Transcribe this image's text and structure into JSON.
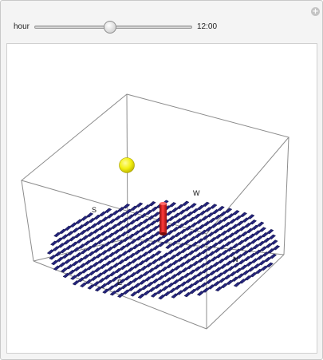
{
  "controls": {
    "hour_label": "hour",
    "hour_value": "12:00",
    "hour_position": 0.5
  },
  "plot": {
    "compass": {
      "south": "S",
      "west": "W",
      "north": "N",
      "east": "E"
    },
    "colors": {
      "panels": "#24247a",
      "panel_edge": "#0e0e45",
      "sun": "#f2ef10",
      "pole": "#d81818",
      "box": "#8c8c8c"
    }
  }
}
